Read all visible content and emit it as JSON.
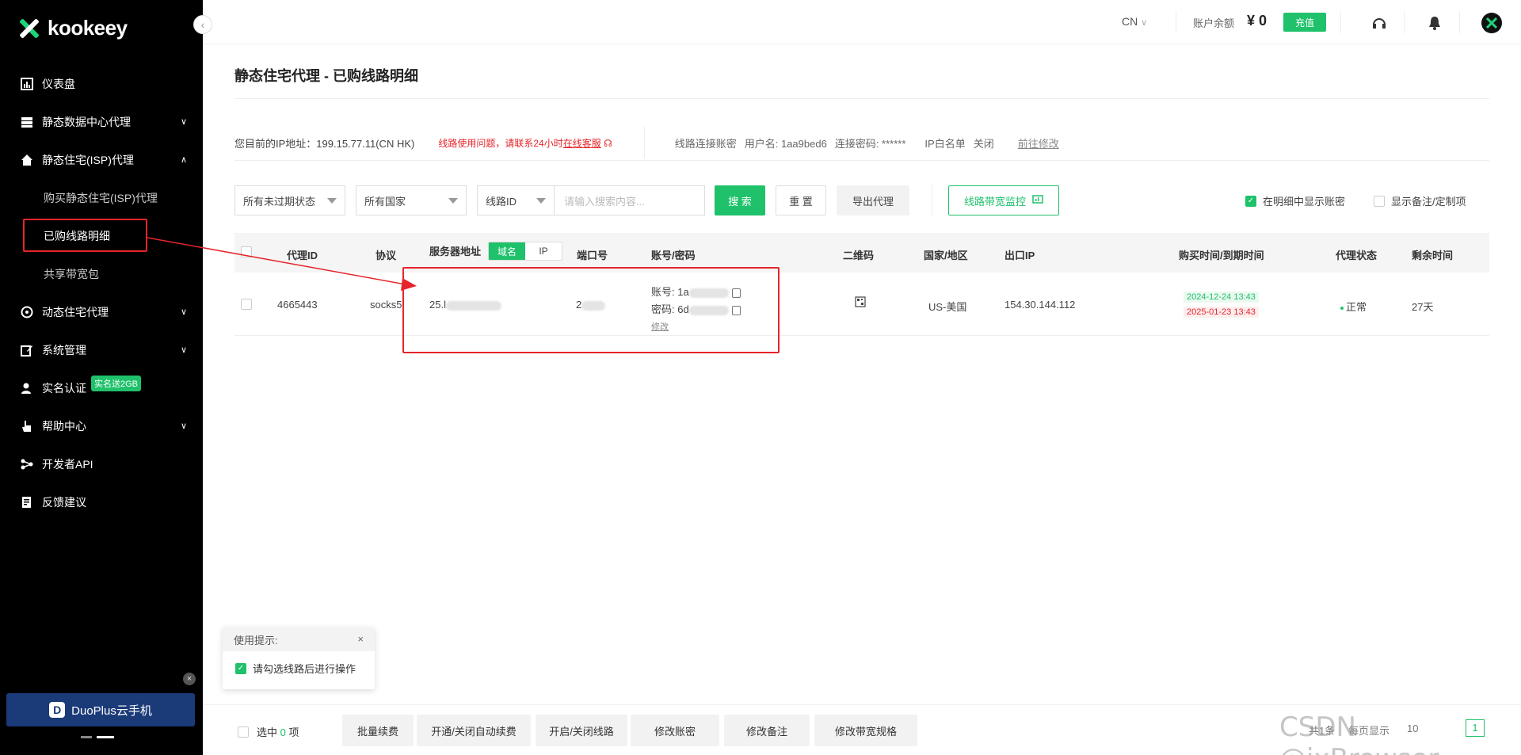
{
  "brand": {
    "logo_text": "kookeey"
  },
  "sidebar": {
    "items": [
      {
        "label": "仪表盘"
      },
      {
        "label": "静态数据中心代理"
      },
      {
        "label": "静态住宅(ISP)代理"
      },
      {
        "label": "动态住宅代理"
      },
      {
        "label": "系统管理"
      },
      {
        "label": "实名认证",
        "badge": "实名送2GB"
      },
      {
        "label": "帮助中心"
      },
      {
        "label": "开发者API"
      },
      {
        "label": "反馈建议"
      }
    ],
    "sub_items": [
      {
        "label": "购买静态住宅(ISP)代理"
      },
      {
        "label": "已购线路明细"
      },
      {
        "label": "共享带宽包"
      }
    ],
    "promo": {
      "label": "DuoPlus云手机",
      "logo": "D"
    }
  },
  "header": {
    "lang": "CN",
    "balance_label": "账户余额",
    "balance_value": "¥ 0",
    "charge_label": "充值"
  },
  "page": {
    "title": "静态住宅代理 - 已购线路明细",
    "ip_info": "您目前的IP地址：199.15.77.11(CN HK)",
    "warn_prefix": "线路使用问题，请联系24小时",
    "warn_link": "在线客服",
    "account_label": "线路连接账密",
    "username": "用户名: 1aa9bed6",
    "password": "连接密码: ******",
    "whitelist_label": "IP白名单",
    "whitelist_value": "关闭",
    "edit_link": "前往修改"
  },
  "filters": {
    "status": "所有未过期状态",
    "country": "所有国家",
    "line_id": "线路ID",
    "search_placeholder": "请输入搜索内容...",
    "search_btn": "搜 索",
    "reset_btn": "重 置",
    "export_btn": "导出代理",
    "monitor_btn": "线路带宽监控",
    "show_account": "在明细中显示账密",
    "show_note": "显示备注/定制项"
  },
  "table": {
    "headers": {
      "id": "代理ID",
      "protocol": "协议",
      "server": "服务器地址",
      "seg_domain": "域名",
      "seg_ip": "IP",
      "port": "端口号",
      "account": "账号/密码",
      "qr": "二维码",
      "country": "国家/地区",
      "exit_ip": "出口IP",
      "time": "购买时间/到期时间",
      "status": "代理状态",
      "remaining": "剩余时间"
    },
    "rows": [
      {
        "id": "4665443",
        "protocol": "socks5",
        "server": "25.l",
        "port": "2",
        "account_label": "账号: ",
        "account_value": "1a",
        "password_label": "密码: ",
        "password_value": "6d",
        "edit": "修改",
        "country": "US-美国",
        "exit_ip": "154.30.144.112",
        "buy_time": "2024-12-24 13:43",
        "expire_time": "2025-01-23 13:43",
        "status": "正常",
        "remaining": "27天"
      }
    ]
  },
  "tip": {
    "title": "使用提示:",
    "body": "请勾选线路后进行操作"
  },
  "bottom": {
    "selected_prefix": "选中",
    "selected_count": "0",
    "selected_suffix": "项",
    "actions": [
      "批量续费",
      "开通/关闭自动续费",
      "开启/关闭线路",
      "修改账密",
      "修改备注",
      "修改带宽规格"
    ],
    "pager_total": "共1条",
    "pager_per": "每页显示",
    "pager_size": "10"
  },
  "watermark": "CSDN @ixBrowser",
  "colors": {
    "accent": "#1fc16b",
    "danger": "#e5252a",
    "sidebar_bg": "#000000"
  }
}
